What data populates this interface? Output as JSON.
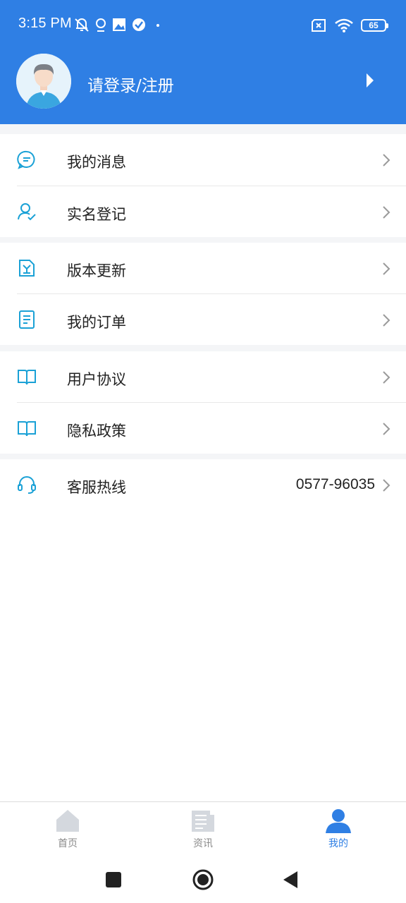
{
  "status_bar": {
    "time": "3:15 PM",
    "battery": "65"
  },
  "profile": {
    "login_text": "请登录/注册"
  },
  "menu": {
    "groups": [
      [
        {
          "label": "我的消息",
          "icon": "message-icon"
        },
        {
          "label": "实名登记",
          "icon": "user-verify-icon"
        }
      ],
      [
        {
          "label": "版本更新",
          "icon": "update-icon"
        },
        {
          "label": "我的订单",
          "icon": "order-icon"
        }
      ],
      [
        {
          "label": "用户协议",
          "icon": "book-icon"
        },
        {
          "label": "隐私政策",
          "icon": "book-icon"
        }
      ],
      [
        {
          "label": "客服热线",
          "icon": "headset-icon",
          "value": "0577-96035"
        }
      ]
    ]
  },
  "tabs": [
    {
      "label": "首页",
      "icon": "home-icon",
      "active": false
    },
    {
      "label": "资讯",
      "icon": "news-icon",
      "active": false
    },
    {
      "label": "我的",
      "icon": "person-icon",
      "active": true
    }
  ],
  "colors": {
    "brand": "#2f7fe4",
    "icon_cyan": "#1aa1d6",
    "inactive": "#c9ced6"
  }
}
